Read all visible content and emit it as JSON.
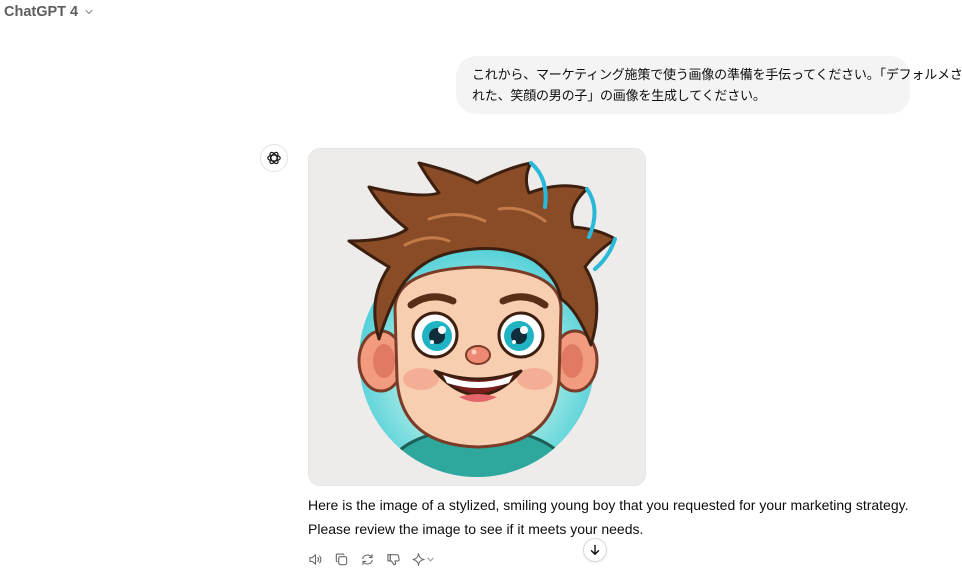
{
  "header": {
    "model_title": "ChatGPT 4"
  },
  "conversation": {
    "user_message": {
      "line1": "これから、マーケティング施策で使う画像の準備を手伝ってください。「デフォルメさ",
      "line2": "れた、笑顔の男の子」の画像を生成してください。"
    },
    "assistant": {
      "image_subject": "stylized smiling boy",
      "text_line1": "Here is the image of a stylized, smiling young boy that you requested for your marketing strategy.",
      "text_line2": "Please review the image to see if it meets your needs."
    }
  },
  "actions": [
    {
      "name": "read-aloud-icon"
    },
    {
      "name": "copy-icon"
    },
    {
      "name": "regenerate-icon"
    },
    {
      "name": "thumbs-down-icon"
    },
    {
      "name": "change-model-sparkle-icon"
    }
  ],
  "colors": {
    "bubble_bg": "#f4f4f4",
    "icon_gray": "#6b6b6b",
    "hair_brown": "#8a4b27",
    "hair_cyan": "#2ab8d8",
    "skin": "#f5c9a5",
    "shirt_teal": "#2ea89c",
    "backdrop_circle": "#4fd3d6"
  }
}
